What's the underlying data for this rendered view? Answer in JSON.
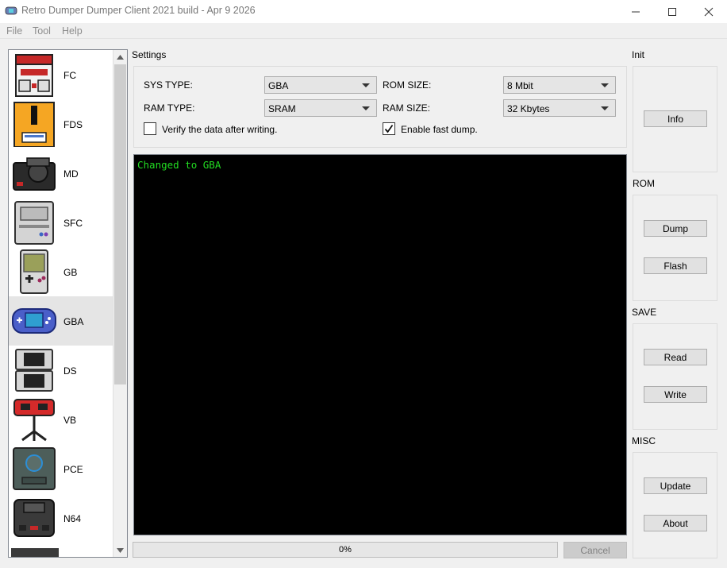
{
  "window": {
    "title": "Retro Dumper Dumper Client 2021 build - Apr  9 2026",
    "icon": "gamepad-icon",
    "controls": [
      "minimize-icon",
      "maximize-icon",
      "close-icon"
    ]
  },
  "menu": [
    "File",
    "Tool",
    "Help"
  ],
  "devices": [
    {
      "label": "FC",
      "icon": "famicom-icon"
    },
    {
      "label": "FDS",
      "icon": "famicom-disk-icon"
    },
    {
      "label": "MD",
      "icon": "mega-drive-icon"
    },
    {
      "label": "SFC",
      "icon": "super-famicom-icon"
    },
    {
      "label": "GB",
      "icon": "game-boy-icon"
    },
    {
      "label": "GBA",
      "icon": "game-boy-advance-icon"
    },
    {
      "label": "DS",
      "icon": "nintendo-ds-icon"
    },
    {
      "label": "VB",
      "icon": "virtual-boy-icon"
    },
    {
      "label": "PCE",
      "icon": "pc-engine-icon"
    },
    {
      "label": "N64",
      "icon": "nintendo-64-icon"
    }
  ],
  "selected_device": "GBA",
  "settings": {
    "title": "Settings",
    "sys_type_label": "SYS TYPE:",
    "sys_type_value": "GBA",
    "ram_type_label": "RAM TYPE:",
    "ram_type_value": "SRAM",
    "rom_size_label": "ROM SIZE:",
    "rom_size_value": "8 Mbit",
    "ram_size_label": "RAM SIZE:",
    "ram_size_value": "32 Kbytes",
    "verify_label": "Verify the data after writing.",
    "verify_checked": false,
    "fast_dump_label": "Enable fast dump.",
    "fast_dump_checked": true
  },
  "console": {
    "text": "Changed to GBA",
    "text_color": "#22dd22"
  },
  "progress": {
    "value": 0,
    "text": "0%"
  },
  "cancel_label": "Cancel",
  "panels": {
    "init": {
      "title": "Init",
      "buttons": [
        "Info"
      ]
    },
    "rom": {
      "title": "ROM",
      "buttons": [
        "Dump",
        "Flash"
      ]
    },
    "save": {
      "title": "SAVE",
      "buttons": [
        "Read",
        "Write"
      ]
    },
    "misc": {
      "title": "MISC",
      "buttons": [
        "Update",
        "About"
      ]
    }
  }
}
